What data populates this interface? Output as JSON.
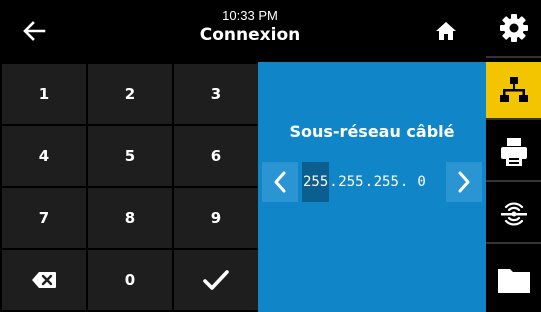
{
  "header": {
    "time": "10:33 PM",
    "title": "Connexion"
  },
  "keypad": {
    "keys": [
      "1",
      "2",
      "3",
      "4",
      "5",
      "6",
      "7",
      "8",
      "9",
      "0"
    ]
  },
  "panel": {
    "title": "Sous-réseau câblé",
    "ip_octets": [
      "255",
      "255",
      "255",
      " 0"
    ],
    "active_octet_index": 0
  },
  "sidebar": {
    "items": [
      "gear-icon",
      "network-icon",
      "printer-icon",
      "rfid-icon",
      "folder-icon"
    ],
    "active_index": 1
  },
  "colors": {
    "panel_blue": "#1086c8",
    "accent_yellow": "#f2c500",
    "key_background": "#1e1e1e"
  }
}
